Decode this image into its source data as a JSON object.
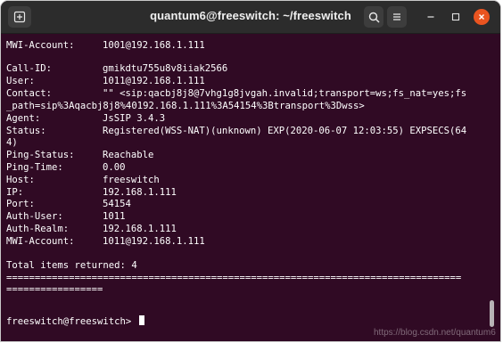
{
  "window": {
    "title": "quantum6@freeswitch: ~/freeswitch",
    "buttons": {
      "new_tab_icon": "terminal-tab-icon",
      "search_icon": "search-icon",
      "menu_icon": "hamburger-icon",
      "minimize_icon": "minimize-icon",
      "maximize_icon": "maximize-icon",
      "close_icon": "close-icon"
    },
    "colors": {
      "titlebar": "#2c2c2c",
      "terminal_bg": "#300a24",
      "close_button": "#e95420",
      "text": "#ffffff"
    }
  },
  "terminal": {
    "top_entry": {
      "mwi_label": "MWI-Account:",
      "mwi_value": "1001@192.168.1.111"
    },
    "registration": {
      "call_id_label": "Call-ID:",
      "call_id": "gmikdtu755u8v8iiak2566",
      "user_label": "User:",
      "user": "1011@192.168.1.111",
      "contact_label": "Contact:",
      "contact_line1": "\"\" <sip:qacbj8j8@7vhg1g8jvgah.invalid;transport=ws;fs_nat=yes;fs",
      "contact_line2": "_path=sip%3Aqacbj8j8%40192.168.1.111%3A54154%3Btransport%3Dwss>",
      "agent_label": "Agent:",
      "agent": "JsSIP 3.4.3",
      "status_label": "Status:",
      "status_line1": "Registered(WSS-NAT)(unknown) EXP(2020-06-07 12:03:55) EXPSECS(64",
      "status_line2": "4)",
      "ping_status_label": "Ping-Status:",
      "ping_status": "Reachable",
      "ping_time_label": "Ping-Time:",
      "ping_time": "0.00",
      "host_label": "Host:",
      "host": "freeswitch",
      "ip_label": "IP:",
      "ip": "192.168.1.111",
      "port_label": "Port:",
      "port": "54154",
      "auth_user_label": "Auth-User:",
      "auth_user": "1011",
      "auth_realm_label": "Auth-Realm:",
      "auth_realm": "192.168.1.111",
      "mwi_label": "MWI-Account:",
      "mwi_account": "1011@192.168.1.111"
    },
    "total_line": "Total items returned: 4",
    "separator_line1": "================================================================================",
    "separator_line2": "=================",
    "prompt": "freeswitch@freeswitch> "
  },
  "watermark": "https://blog.csdn.net/quantum6"
}
